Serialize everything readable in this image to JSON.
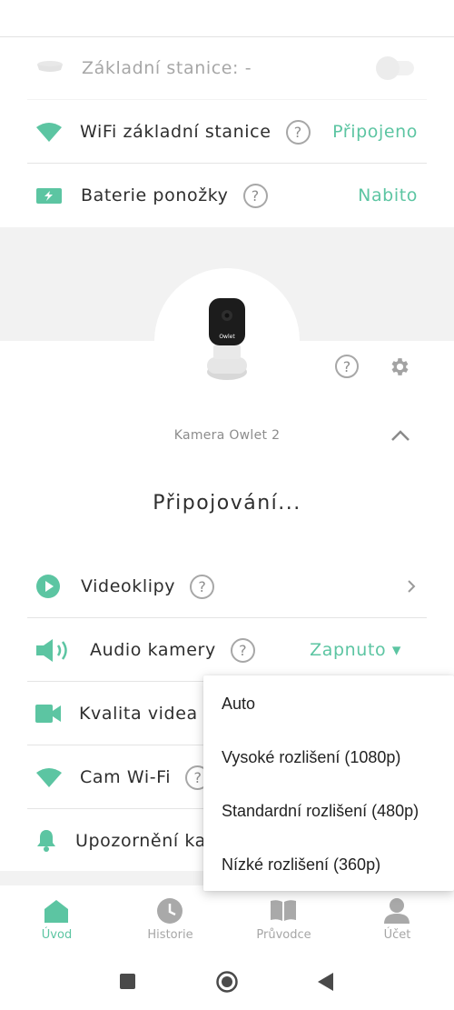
{
  "base_station_row": {
    "label": "Základní stanice: -"
  },
  "wifi_base_row": {
    "label": "WiFi základní stanice",
    "help": "?",
    "value": "Připojeno"
  },
  "battery_row": {
    "label": "Baterie ponožky",
    "help": "?",
    "value": "Nabito"
  },
  "camera": {
    "name": "Kamera Owlet 2",
    "brand": "Owlet",
    "status": "Připojování...",
    "help": "?"
  },
  "videoclips_row": {
    "label": "Videoklipy",
    "help": "?"
  },
  "audio_row": {
    "label": "Audio kamery",
    "help": "?",
    "value": "Zapnuto ▾"
  },
  "quality_row": {
    "label": "Kvalita videa"
  },
  "camwifi_row": {
    "label": "Cam Wi-Fi",
    "help": "?"
  },
  "alerts_row": {
    "label": "Upozornění kamery"
  },
  "quality_dropdown": {
    "options": [
      "Auto",
      "Vysoké rozlišení (1080p)",
      "Standardní rozlišení (480p)",
      "Nízké rozlišení (360p)"
    ]
  },
  "tabs": [
    {
      "label": "Úvod",
      "icon": "home-icon",
      "active": true
    },
    {
      "label": "Historie",
      "icon": "clock-icon",
      "active": false
    },
    {
      "label": "Průvodce",
      "icon": "book-icon",
      "active": false
    },
    {
      "label": "Účet",
      "icon": "person-icon",
      "active": false
    }
  ],
  "colors": {
    "accent": "#5cc5a2",
    "text": "#2e2e2e",
    "muted": "#a6a6a6",
    "band": "#f2f2f2"
  }
}
